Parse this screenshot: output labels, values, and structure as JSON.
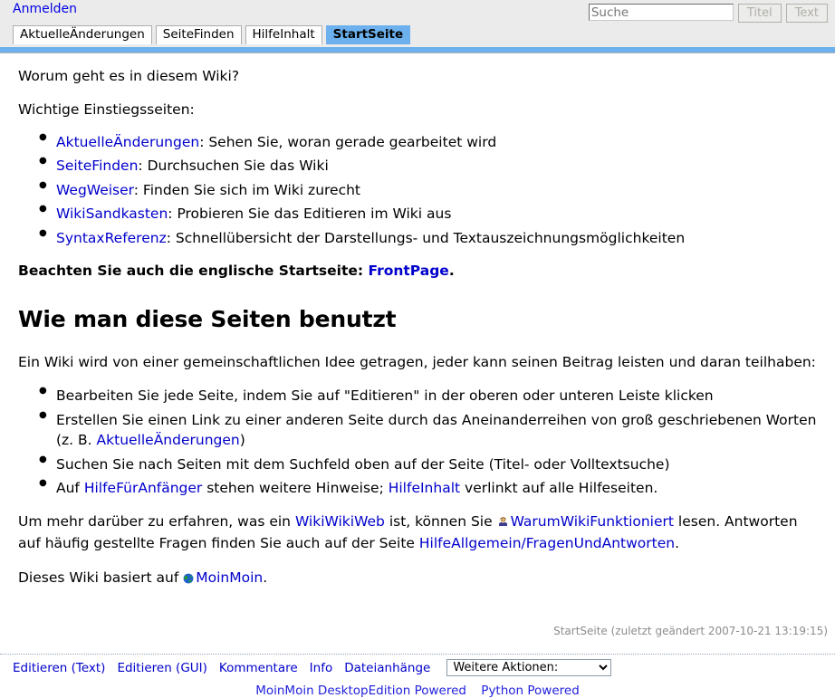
{
  "header": {
    "login_label": "Anmelden",
    "search": {
      "placeholder": "Suche",
      "value": "",
      "title_button": "Titel",
      "text_button": "Text"
    },
    "tabs": [
      {
        "label": "AktuelleÄnderungen",
        "current": false
      },
      {
        "label": "SeiteFinden",
        "current": false
      },
      {
        "label": "HilfeInhalt",
        "current": false
      },
      {
        "label": "StartSeite",
        "current": true
      }
    ]
  },
  "content": {
    "intro_question": "Worum geht es in diesem Wiki?",
    "entry_heading": "Wichtige Einstiegsseiten:",
    "entry_links": [
      {
        "link": "AktuelleÄnderungen",
        "rest": ": Sehen Sie, woran gerade gearbeitet wird"
      },
      {
        "link": "SeiteFinden",
        "rest": ": Durchsuchen Sie das Wiki"
      },
      {
        "link": "WegWeiser",
        "rest": ": Finden Sie sich im Wiki zurecht"
      },
      {
        "link": "WikiSandkasten",
        "rest": ": Probieren Sie das Editieren im Wiki aus"
      },
      {
        "link": "SyntaxReferenz",
        "rest": ": Schnellübersicht der Darstellungs- und Textauszeichnungsmöglichkeiten"
      }
    ],
    "note_prefix": "Beachten Sie auch die englische Startseite: ",
    "note_link": "FrontPage",
    "note_suffix": ".",
    "section_title": "Wie man diese Seiten benutzt",
    "section_intro": "Ein Wiki wird von einer gemeinschaftlichen Idee getragen, jeder kann seinen Beitrag leisten und daran teilhaben:",
    "howto_item_1": "Bearbeiten Sie jede Seite, indem Sie auf \"Editieren\" in der oberen oder unteren Leiste klicken",
    "howto_item_2_pre": "Erstellen Sie einen Link zu einer anderen Seite durch das Aneinanderreihen von groß geschriebenen Worten (z. B. ",
    "howto_item_2_link": "AktuelleÄnderungen",
    "howto_item_2_post": ")",
    "howto_item_3": "Suchen Sie nach Seiten mit dem Suchfeld oben auf der Seite (Titel- oder Volltextsuche)",
    "howto_item_4_pre": "Auf ",
    "howto_item_4_link1": "HilfeFürAnfänger",
    "howto_item_4_mid": " stehen weitere Hinweise; ",
    "howto_item_4_link2": "HilfeInhalt",
    "howto_item_4_post": " verlinkt auf alle Hilfeseiten.",
    "para_more_pre": "Um mehr darüber zu erfahren, was ein ",
    "para_more_link1": "WikiWikiWeb",
    "para_more_mid": " ist, können Sie ",
    "para_more_link2": "WarumWikiFunktioniert",
    "para_more_post": " lesen. Antworten auf häufig gestellte Fragen finden Sie auch auf der Seite ",
    "para_more_link3": "HilfeAllgemein/FragenUndAntworten",
    "para_more_end": ".",
    "based_on_pre": "Dieses Wiki basiert auf ",
    "based_on_link": "MoinMoin",
    "based_on_post": ".",
    "icon_user": "user-icon",
    "icon_globe": "globe-icon"
  },
  "pageinfo": {
    "text": "StartSeite (zuletzt geändert 2007-10-21 13:19:15)"
  },
  "footer": {
    "actions": [
      "Editieren (Text)",
      "Editieren (GUI)",
      "Kommentare",
      "Info",
      "Dateianhänge"
    ],
    "more_actions_label": "Weitere Aktionen:",
    "more_actions_options": [
      "Weitere Aktionen:"
    ],
    "credits": [
      "MoinMoin DesktopEdition Powered",
      "Python Powered"
    ]
  },
  "colors": {
    "header_bg": "#ebebeb",
    "tab_active_bg": "#6cb0ee",
    "link": "#0000cc",
    "pageinfo_text": "#8c8c8c"
  }
}
